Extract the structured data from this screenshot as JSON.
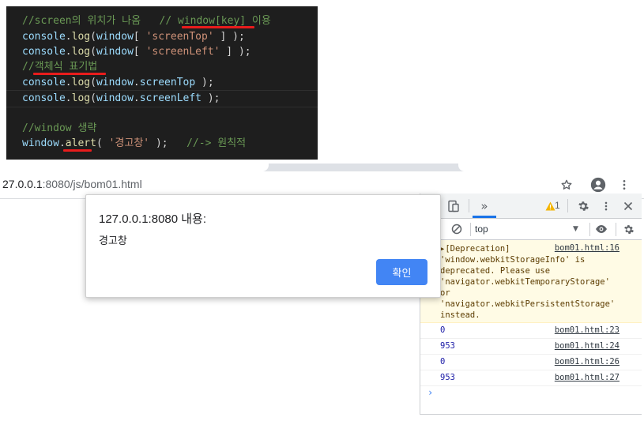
{
  "code": {
    "line1": {
      "comment": "//screen의 위치가 나옴",
      "comment2": "// ",
      "comment3": "window[key]",
      "comment4": " 이용"
    },
    "line2": {
      "obj": "console",
      "dot": ".",
      "fn": "log",
      "open": "(",
      "win": "window",
      "br": "[ ",
      "str": "'screenTop'",
      "close": " ] );"
    },
    "line3": {
      "obj": "console",
      "dot": ".",
      "fn": "log",
      "open": "(",
      "win": "window",
      "br": "[ ",
      "str": "'screenLeft'",
      "close": " ] );"
    },
    "line4": {
      "comment": "//",
      "comment2": "객체식 표기법"
    },
    "line5": {
      "obj": "console",
      "dot": ".",
      "fn": "log",
      "open": "(",
      "win": "window",
      "dot2": ".",
      "prop": "screenTop",
      "close": " );"
    },
    "line6": {
      "obj": "console",
      "dot": ".",
      "fn": "log",
      "open": "(",
      "win": "window",
      "dot2": ".",
      "prop": "screenLeft",
      "close": " );"
    },
    "line8": {
      "comment": "//window 생략"
    },
    "line9": {
      "win": "window",
      "dot": ".",
      "fn": "alert",
      "open": "( ",
      "str": "'경고창'",
      "close": " );",
      "comment": "//-> 원칙적"
    }
  },
  "browser": {
    "url_host": "27.0.0.1",
    "url_rest": ":8080/js/bom01.html",
    "icons": [
      "star-icon",
      "account-icon",
      "more-vert-icon"
    ]
  },
  "dialog": {
    "title": "127.0.0.1:8080 내용:",
    "message": "경고창",
    "ok_label": "확인"
  },
  "devtools": {
    "more_tabs": "»",
    "warning_count": "1",
    "context": "top",
    "warning": {
      "text": "▸[Deprecation]\n'window.webkitStorageInfo' is\ndeprecated. Please use\n'navigator.webkitTemporaryStorage'\nor\n'navigator.webkitPersistentStorage'\ninstead.",
      "source": "bom01.html:16"
    },
    "logs": [
      {
        "value": "0",
        "source": "bom01.html:23"
      },
      {
        "value": "953",
        "source": "bom01.html:24"
      },
      {
        "value": "0",
        "source": "bom01.html:26"
      },
      {
        "value": "953",
        "source": "bom01.html:27"
      }
    ],
    "prompt": "›"
  },
  "colors": {
    "editor_bg": "#1e1e1e",
    "comment": "#6a9955",
    "string": "#ce9178",
    "underline": "#e81c1c",
    "button": "#4285f4",
    "warn_bg": "#fffbe5",
    "log_number": "#1a1aa6"
  }
}
